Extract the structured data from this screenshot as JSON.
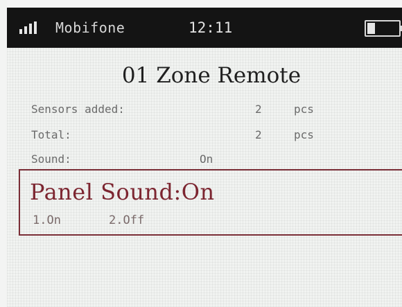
{
  "status": {
    "carrier": "Mobifone",
    "time": "12:11",
    "battery_level": 0.25
  },
  "screen": {
    "title": "01 Zone Remote",
    "rows": [
      {
        "label": "Sensors added:",
        "value": "2",
        "unit": "pcs"
      },
      {
        "label": "Total:",
        "value": "2",
        "unit": "pcs"
      },
      {
        "label": "Sound:",
        "value": "On"
      }
    ]
  },
  "dialog": {
    "title": "Panel Sound:On",
    "options": [
      "1.On",
      "2.Off"
    ]
  },
  "colors": {
    "status_bar": "#141414",
    "screen_bg": "#f1f3f1",
    "dialog_border": "#7a2d36",
    "dialog_text": "#7c2530"
  },
  "icons": [
    "signal-icon",
    "battery-icon"
  ]
}
